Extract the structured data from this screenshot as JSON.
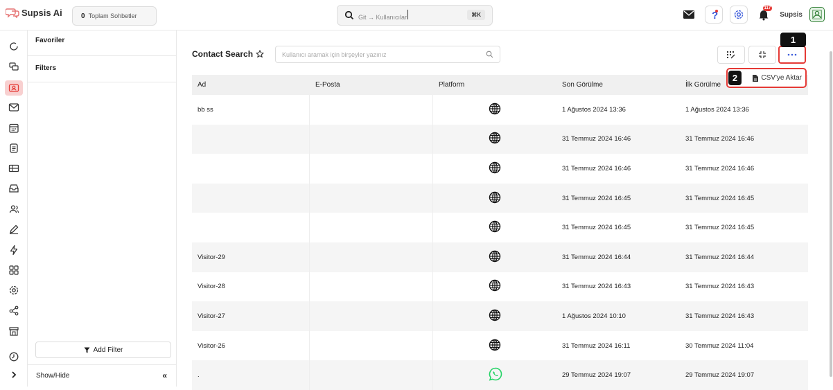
{
  "app": {
    "logo_text": "Supsis Ai"
  },
  "header": {
    "chat_count": "0",
    "chat_count_label": "Toplam Sohbetler",
    "search_text": "Git → Kullanıcılar",
    "search_shortcut": "⌘K",
    "notification_count": "117",
    "username": "Supsis"
  },
  "filters_panel": {
    "favorites_label": "Favoriler",
    "filters_label": "Filters",
    "add_filter_label": "Add Filter",
    "show_hide_label": "Show/Hide"
  },
  "contact_search": {
    "title": "Contact Search",
    "search_placeholder": "Kullanıcı aramak için birşeyler yazınız",
    "export_label": "CSV'ye Aktar"
  },
  "annotations": {
    "step1": "1",
    "step2": "2"
  },
  "table": {
    "columns": [
      "Ad",
      "E-Posta",
      "Platform",
      "Son Görülme",
      "İlk Görülme"
    ],
    "rows": [
      {
        "name": "bb ss",
        "email": "",
        "platform": "web",
        "last_seen": "1 Ağustos 2024 13:36",
        "first_seen": "1 Ağustos 2024 13:36"
      },
      {
        "name": "",
        "email": "",
        "platform": "web",
        "last_seen": "31 Temmuz 2024 16:46",
        "first_seen": "31 Temmuz 2024 16:46"
      },
      {
        "name": "",
        "email": "",
        "platform": "web",
        "last_seen": "31 Temmuz 2024 16:46",
        "first_seen": "31 Temmuz 2024 16:46"
      },
      {
        "name": "",
        "email": "",
        "platform": "web",
        "last_seen": "31 Temmuz 2024 16:45",
        "first_seen": "31 Temmuz 2024 16:45"
      },
      {
        "name": "",
        "email": "",
        "platform": "web",
        "last_seen": "31 Temmuz 2024 16:45",
        "first_seen": "31 Temmuz 2024 16:45"
      },
      {
        "name": "Visitor-29",
        "email": "",
        "platform": "web",
        "last_seen": "31 Temmuz 2024 16:44",
        "first_seen": "31 Temmuz 2024 16:44"
      },
      {
        "name": "Visitor-28",
        "email": "",
        "platform": "web",
        "last_seen": "31 Temmuz 2024 16:43",
        "first_seen": "31 Temmuz 2024 16:43"
      },
      {
        "name": "Visitor-27",
        "email": "",
        "platform": "web",
        "last_seen": "1 Ağustos 2024 10:10",
        "first_seen": "31 Temmuz 2024 16:43"
      },
      {
        "name": "Visitor-26",
        "email": "",
        "platform": "web",
        "last_seen": "31 Temmuz 2024 16:11",
        "first_seen": "30 Temmuz 2024 11:04"
      },
      {
        "name": ".",
        "email": "",
        "platform": "whatsapp",
        "last_seen": "29 Temmuz 2024 19:07",
        "first_seen": "29 Temmuz 2024 19:07"
      }
    ]
  },
  "colors": {
    "accent_red": "#e53935",
    "whatsapp_green": "#25d366"
  }
}
